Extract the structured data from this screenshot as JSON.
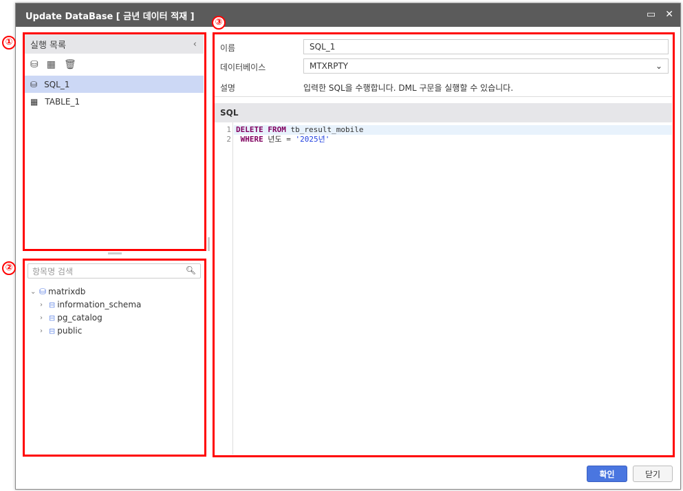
{
  "window": {
    "title": "Update DataBase [ 금년 데이터 적재 ]",
    "maximize_icon": "maximize-icon",
    "close_icon": "close-icon"
  },
  "annotations": [
    "①",
    "②",
    "③"
  ],
  "exec_list": {
    "title": "실행 목록",
    "collapse_icon": "chevron-left-icon",
    "items": [
      {
        "label": "SQL_1",
        "icon": "sql-db-icon",
        "selected": true
      },
      {
        "label": "TABLE_1",
        "icon": "table-icon",
        "selected": false
      }
    ]
  },
  "tree": {
    "search_placeholder": "항목명 검색",
    "root": "matrixdb",
    "children": [
      "information_schema",
      "pg_catalog",
      "public"
    ]
  },
  "form": {
    "name_label": "이름",
    "name_value": "SQL_1",
    "db_label": "데이터베이스",
    "db_value": "MTXRPTY",
    "desc_label": "설명",
    "desc_value": "입력한 SQL을 수행합니다. DML 구문을 실행할 수 있습니다."
  },
  "sql": {
    "title": "SQL",
    "lines": [
      {
        "n": "1",
        "kw1": "DELETE FROM",
        "rest": " tb_result_mobile"
      },
      {
        "n": "2",
        "kw1": " WHERE",
        "rest": " 년도 = ",
        "str": "'2025년'"
      }
    ]
  },
  "buttons": {
    "ok": "확인",
    "close": "닫기"
  },
  "colors": {
    "accent": "#4a76e0",
    "annotation": "#ff0000",
    "titlebar": "#5b5b5b"
  }
}
